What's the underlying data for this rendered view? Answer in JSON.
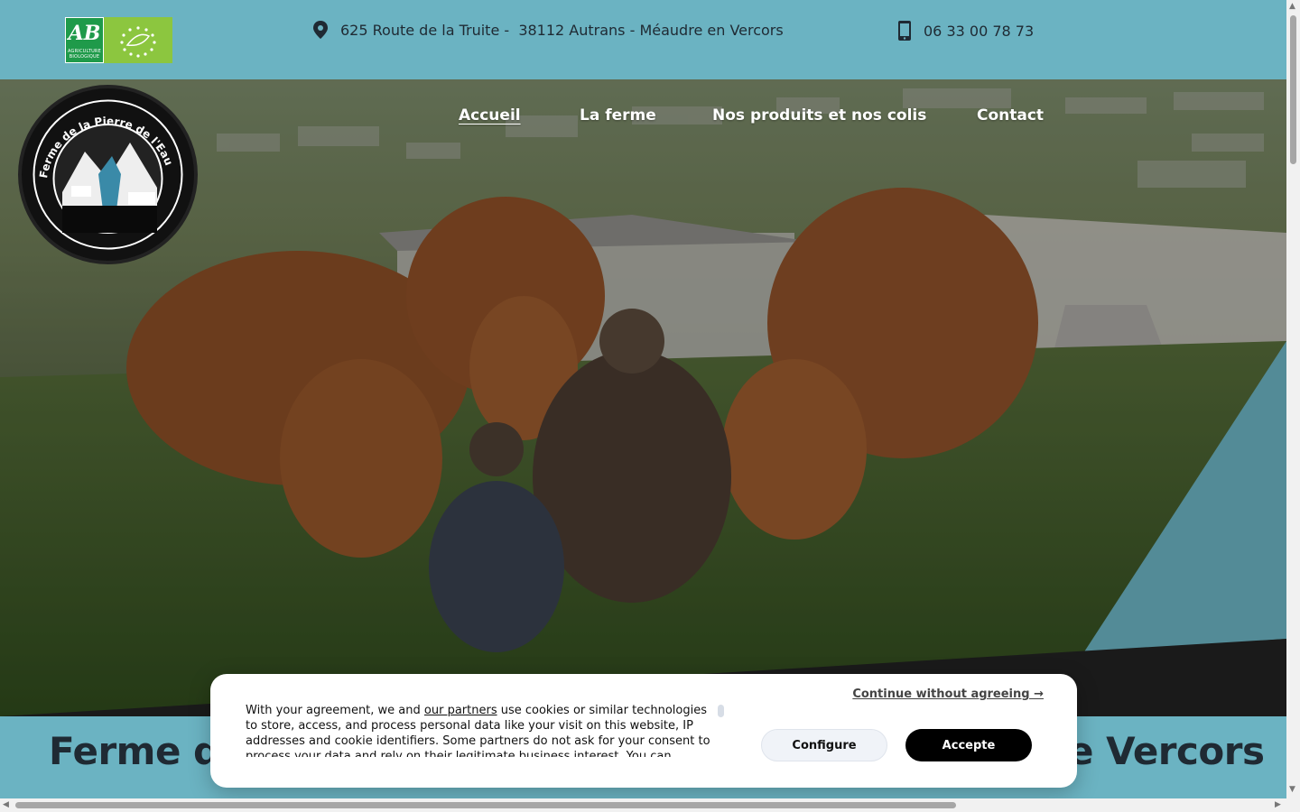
{
  "header": {
    "bio_logo": {
      "letters": "AB",
      "caption": "AGRICULTURE BIOLOGIQUE",
      "icon": "organic-label-icon"
    },
    "address": "625 Route de la Truite -  38112 Autrans - Méaudre en Vercors",
    "address_icon": "location-pin-icon",
    "phone": "06 33 00 78 73",
    "phone_icon": "mobile-phone-icon"
  },
  "logo": {
    "text": "Ferme de la Pierre de l'Eau"
  },
  "nav": {
    "items": [
      {
        "label": "Accueil",
        "active": true
      },
      {
        "label": "La ferme",
        "active": false
      },
      {
        "label": "Nos produits et nos colis",
        "active": false
      },
      {
        "label": "Contact",
        "active": false
      }
    ]
  },
  "hero": {
    "image_description": "cows-in-pasture-photo"
  },
  "title": {
    "visible_left": "Ferme de",
    "visible_right": "e Vercors"
  },
  "cookie_banner": {
    "text_before_link": "With your agreement, we and ",
    "link": "our partners",
    "text_after_link": " use cookies or similar technologies to store, access, and process personal data like your visit on this website, IP addresses and cookie identifiers. Some partners do not ask for your consent to process your data and rely on their legitimate business interest. You can",
    "continue_label": "Continue without agreeing →",
    "configure_label": "Configure",
    "accept_label": "Accepte"
  },
  "colors": {
    "teal": "#6bb3c2",
    "dark": "#1f2a33",
    "accept_bg": "#000000"
  }
}
